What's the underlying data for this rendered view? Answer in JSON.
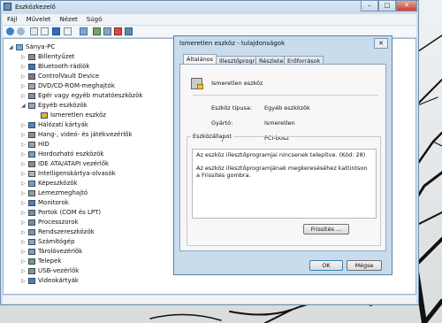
{
  "window": {
    "title": "Eszközkezelő",
    "controls": [
      "–",
      "□",
      "✕"
    ]
  },
  "menu": [
    "Fájl",
    "Művelet",
    "Nézet",
    "Súgó"
  ],
  "toolbar_icons": [
    "back-icon",
    "forward-icon",
    "tree-view-icon",
    "properties-icon",
    "help-icon",
    "list-view-icon",
    "scan-icon",
    "update-driver-icon",
    "disable-device-icon",
    "uninstall-icon",
    "enable-device-icon"
  ],
  "tree": {
    "root": "Sánya-PC",
    "items": [
      {
        "label": "Billentyűzet",
        "expanded": false,
        "icon": "keyboard-icon"
      },
      {
        "label": "Bluetooth-rádiók",
        "expanded": false,
        "icon": "bluetooth-icon"
      },
      {
        "label": "ControlVault Device",
        "expanded": false,
        "icon": "device-icon"
      },
      {
        "label": "DVD/CD-ROM-meghajtók",
        "expanded": false,
        "icon": "disc-drive-icon"
      },
      {
        "label": "Egér vagy egyéb mutatóeszközök",
        "expanded": false,
        "icon": "mouse-icon"
      },
      {
        "label": "Egyéb eszközök",
        "expanded": true,
        "icon": "other-devices-icon"
      },
      {
        "label": "Ismeretlen eszköz",
        "child": true,
        "icon": "warning-device-icon"
      },
      {
        "label": "Hálózati kártyák",
        "expanded": false,
        "icon": "network-icon"
      },
      {
        "label": "Hang-, videó- és játékvezérlők",
        "expanded": false,
        "icon": "sound-icon"
      },
      {
        "label": "HID",
        "expanded": false,
        "icon": "hid-icon"
      },
      {
        "label": "Hordozható eszközök",
        "expanded": false,
        "icon": "portable-icon"
      },
      {
        "label": "IDE ATA/ATAPI vezérlők",
        "expanded": false,
        "icon": "ide-icon"
      },
      {
        "label": "Intelligenskártya-olvasók",
        "expanded": false,
        "icon": "smartcard-icon"
      },
      {
        "label": "Képeszközök",
        "expanded": false,
        "icon": "camera-icon"
      },
      {
        "label": "Lemezmeghajtó",
        "expanded": false,
        "icon": "disk-icon"
      },
      {
        "label": "Monitorok",
        "expanded": false,
        "icon": "monitor-icon"
      },
      {
        "label": "Portok (COM és LPT)",
        "expanded": false,
        "icon": "port-icon"
      },
      {
        "label": "Processzorok",
        "expanded": false,
        "icon": "cpu-icon"
      },
      {
        "label": "Rendszereszközök",
        "expanded": false,
        "icon": "system-icon"
      },
      {
        "label": "Számítógép",
        "expanded": false,
        "icon": "computer-icon"
      },
      {
        "label": "Tárolóvezérlők",
        "expanded": false,
        "icon": "storage-icon"
      },
      {
        "label": "Telepek",
        "expanded": false,
        "icon": "battery-icon"
      },
      {
        "label": "USB-vezérlők",
        "expanded": false,
        "icon": "usb-icon"
      },
      {
        "label": "Videokártyák",
        "expanded": false,
        "icon": "display-adapter-icon"
      }
    ]
  },
  "dialog": {
    "title": "Ismeretlen eszköz - tulajdonságok",
    "close": "✕",
    "tabs": [
      "Általános",
      "Illesztőprogram",
      "Részletek",
      "Erőforrások"
    ],
    "active_tab": "Általános",
    "device_name": "Ismeretlen eszköz",
    "fields": [
      {
        "label": "Eszköz típusa:",
        "value": "Egyéb eszközök"
      },
      {
        "label": "Gyártó:",
        "value": "Ismeretlen"
      },
      {
        "label": "Hely:",
        "value": "PCI-busz"
      }
    ],
    "status_group": "Eszközállapot",
    "status_line1": "Az eszköz illesztőprogramjai nincsenek telepítve. (Kód: 28)",
    "status_line2": "Az eszköz illesztőprogramjának megkereséséhez kattintson a Frissítés gombra.",
    "refresh_button": "Frissítés ...",
    "ok_button": "OK",
    "cancel_button": "Mégse"
  }
}
